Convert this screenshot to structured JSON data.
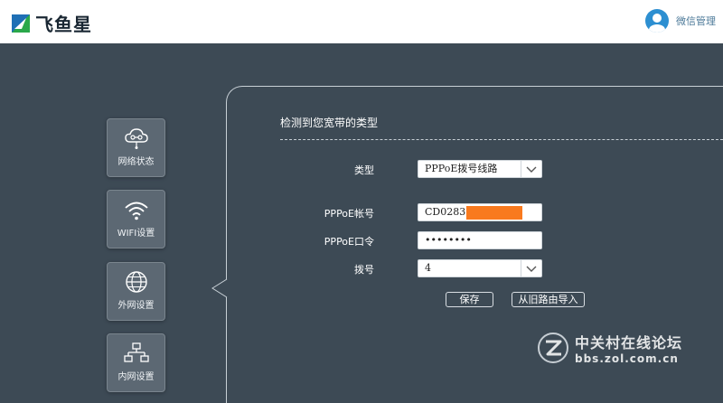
{
  "header": {
    "brand": "飞鱼星",
    "account_label": "微信管理"
  },
  "sidebar": {
    "items": [
      {
        "label": "网络状态",
        "icon": "cloud-network-icon"
      },
      {
        "label": "WIFI设置",
        "icon": "wifi-icon"
      },
      {
        "label": "外网设置",
        "icon": "globe-icon"
      },
      {
        "label": "内网设置",
        "icon": "lan-topology-icon"
      }
    ]
  },
  "main": {
    "section_title": "检测到您宽带的类型",
    "type": {
      "label": "类型",
      "value": "PPPoE拨号线路"
    },
    "account": {
      "label": "PPPoE帐号",
      "value": "CD0283"
    },
    "password": {
      "label": "PPPoE口令",
      "value": "••••••••"
    },
    "dial": {
      "label": "拨号",
      "value": "4"
    },
    "buttons": {
      "save": "保存",
      "import": "从旧路由导入"
    }
  },
  "watermark": {
    "title": "中关村在线论坛",
    "url": "bbs.zol.com.cn"
  },
  "colors": {
    "background": "#3d4a55",
    "accent_blue": "#2d8fd1",
    "redaction": "#f97a1e"
  }
}
